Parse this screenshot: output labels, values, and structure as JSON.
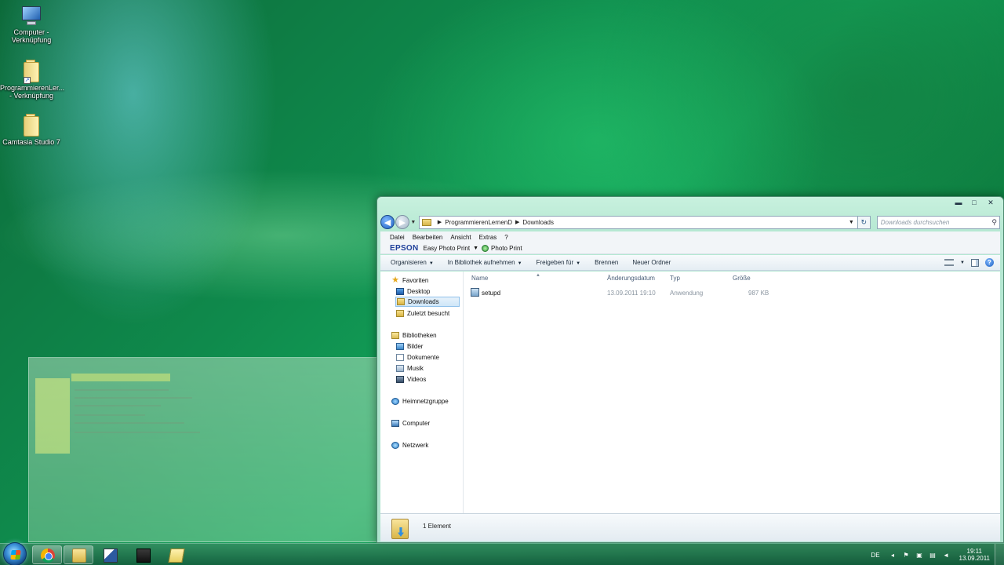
{
  "desktop": {
    "icons": [
      {
        "label_line1": "Computer -",
        "label_line2": "Verknüpfung",
        "icon": "computer-shortcut-icon"
      },
      {
        "label_line1": "ProgrammierenLer...",
        "label_line2": "- Verknüpfung",
        "icon": "folder-shortcut-icon"
      },
      {
        "label_line1": "Camtasia Studio 7",
        "label_line2": "",
        "icon": "folder-icon"
      }
    ]
  },
  "explorer": {
    "caption_buttons": {
      "minimize": "▬",
      "maximize": "□",
      "close": "✕"
    },
    "address": {
      "breadcrumbs": [
        "ProgrammierenLernenD",
        "Downloads"
      ]
    },
    "search": {
      "placeholder": "Downloads durchsuchen"
    },
    "menu": [
      "Datei",
      "Bearbeiten",
      "Ansicht",
      "Extras",
      "?"
    ],
    "epson": {
      "logo": "EPSON",
      "app1": "Easy Photo Print",
      "app2": "Photo Print"
    },
    "toolbar": {
      "organize": "Organisieren",
      "include_library": "In Bibliothek aufnehmen",
      "share": "Freigeben für",
      "burn": "Brennen",
      "new_folder": "Neuer Ordner"
    },
    "nav": {
      "favorites": "Favoriten",
      "desktop": "Desktop",
      "downloads": "Downloads",
      "recent": "Zuletzt besucht",
      "libraries": "Bibliotheken",
      "pictures": "Bilder",
      "documents": "Dokumente",
      "music": "Musik",
      "videos": "Videos",
      "homegroup": "Heimnetzgruppe",
      "computer": "Computer",
      "network": "Netzwerk"
    },
    "columns": {
      "name": "Name",
      "date": "Änderungsdatum",
      "type": "Typ",
      "size": "Größe"
    },
    "files": [
      {
        "name": "setupd",
        "date": "13.09.2011 19:10",
        "type": "Anwendung",
        "size": "987 KB"
      }
    ],
    "status": {
      "count": "1 Element"
    }
  },
  "taskbar": {
    "apps": [
      "chrome",
      "windows-explorer",
      "app",
      "camtasia",
      "sticky-notes"
    ],
    "tray": {
      "lang": "DE",
      "time": "19:11",
      "date": "13.09.2011"
    }
  },
  "colors": {
    "window_frame": "#b6e8d3",
    "selection": "#cfe6f8",
    "desktop_green": "#0f8a4c"
  }
}
